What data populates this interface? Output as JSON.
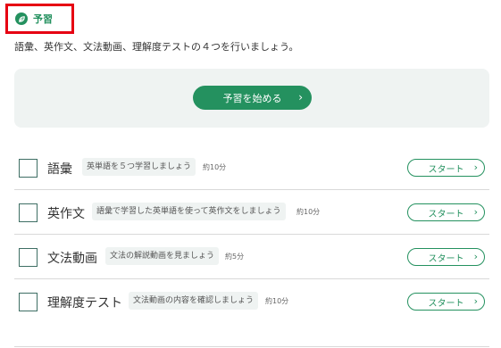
{
  "section": {
    "title": "予習",
    "icon": "leaf-icon",
    "accent": "#24915f",
    "highlight": "#e60012"
  },
  "intro": "語彙、英作文、文法動画、理解度テストの４つを行いましょう。",
  "start_button": {
    "label": "予習を始める",
    "icon": "chevron-right-icon"
  },
  "tasks": [
    {
      "name": "語彙",
      "description": "英単語を５つ学習しましょう",
      "time": "約10分",
      "action": "スタート"
    },
    {
      "name": "英作文",
      "description": "語彙で学習した英単語を使って英作文をしましょう",
      "time": "約10分",
      "action": "スタート"
    },
    {
      "name": "文法動画",
      "description": "文法の解説動画を見ましょう",
      "time": "約5分",
      "action": "スタート"
    },
    {
      "name": "理解度テスト",
      "description": "文法動画の内容を確認しましょう",
      "time": "約10分",
      "action": "スタート"
    }
  ]
}
